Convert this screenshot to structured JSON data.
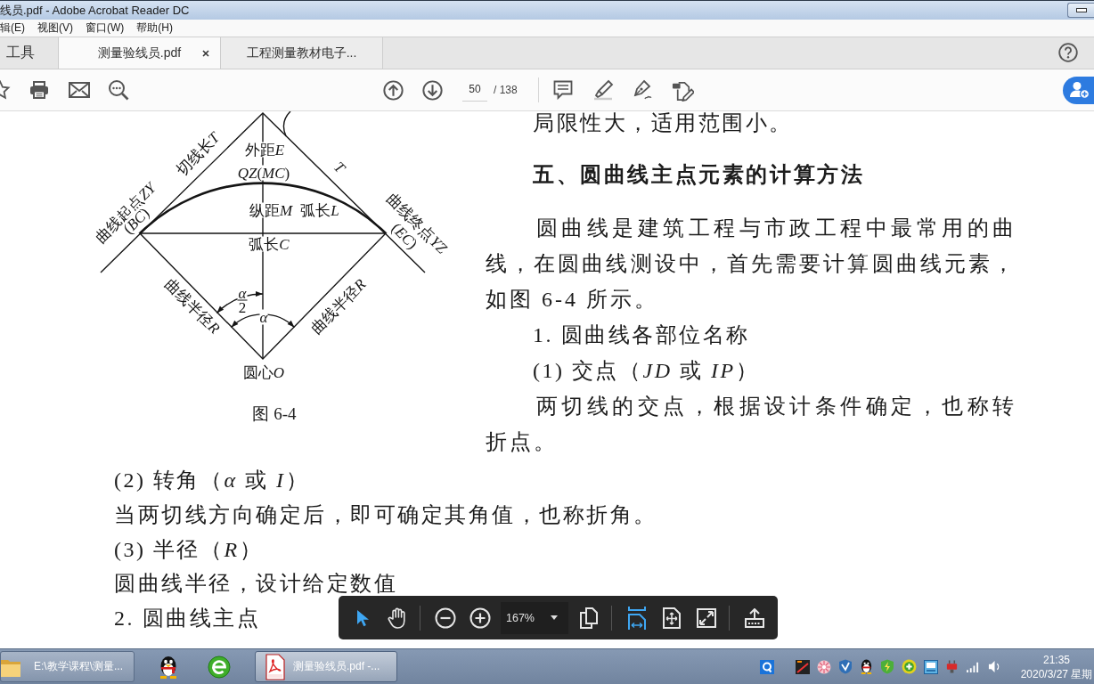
{
  "window": {
    "title": "线员.pdf - Adobe Acrobat Reader DC"
  },
  "menu": [
    "辑(E)",
    "视图(V)",
    "窗口(W)",
    "帮助(H)"
  ],
  "tabs": [
    {
      "label": "工具",
      "selected": false
    },
    {
      "label": "测量验线员.pdf",
      "selected": true
    },
    {
      "label": "工程测量教材电子...",
      "selected": false
    }
  ],
  "page_nav": {
    "page": "50",
    "total": "/ 138"
  },
  "figure": {
    "labels": [
      {
        "kind": "label",
        "text": "外距",
        "symbol": "E"
      },
      {
        "kind": "label",
        "text": "切线长",
        "symbol": "T"
      },
      {
        "kind": "rich",
        "text": "*QZ*(*MC*)"
      },
      {
        "kind": "symbol",
        "text": "T"
      },
      {
        "kind": "label",
        "text": "曲线起点",
        "symbol": "ZY"
      },
      {
        "kind": "rich",
        "text": "(*BC*)"
      },
      {
        "kind": "label",
        "text": "纵距",
        "symbol": "M"
      },
      {
        "kind": "label",
        "text": "弧长",
        "symbol": "L"
      },
      {
        "kind": "label",
        "text": "弧长",
        "symbol": "C"
      },
      {
        "kind": "label",
        "text": "曲线终点",
        "symbol": "YZ"
      },
      {
        "kind": "rich",
        "text": "(*EC*)"
      },
      {
        "kind": "label",
        "text": "曲线半径",
        "symbol": "R"
      },
      {
        "kind": "label",
        "text": "曲线半径",
        "symbol": "R"
      },
      {
        "kind": "fraction",
        "numerator": "α",
        "denominator": "2"
      },
      {
        "kind": "symbol",
        "text": "α"
      },
      {
        "kind": "label",
        "text": "圆心",
        "symbol": "O"
      }
    ],
    "caption": "图 6-4"
  },
  "column": [
    {
      "kind": "text",
      "text": "局限性大，适用范围小。"
    },
    {
      "kind": "heading",
      "text": "五、圆曲线主点元素的计算方法"
    },
    {
      "kind": "paragraph",
      "text": "圆曲线是建筑工程与市政工程中最常用的曲线，在圆曲线测设中，首先需要计算圆曲线元素，如图 6-4 所示。"
    },
    {
      "kind": "text",
      "text": "1. 圆曲线各部位名称"
    },
    {
      "kind": "text",
      "text": "(1) 交点（*JD* 或 *IP*）"
    },
    {
      "kind": "paragraph",
      "text": "两切线的交点，根据设计条件确定，也称转折点。"
    }
  ],
  "body": [
    "(2) 转角（*α* 或 *I*）",
    "当两切线方向确定后，即可确定其角值，也称折角。",
    "(3) 半径（*R*）",
    "圆曲线半径，设计给定数值",
    "2. 圆曲线主点"
  ],
  "view_tools": [
    {
      "kind": "select",
      "selected": true
    },
    {
      "kind": "hand",
      "selected": false
    },
    {
      "kind": "zoom-out",
      "selected": false
    },
    {
      "kind": "zoom-in",
      "selected": false
    },
    {
      "kind": "zoom",
      "label": "167%",
      "selected": false
    },
    {
      "kind": "page-display",
      "selected": false
    },
    {
      "kind": "fit-width",
      "selected": true
    },
    {
      "kind": "fit-page",
      "selected": false
    },
    {
      "kind": "fullscreen",
      "selected": false
    },
    {
      "kind": "share",
      "selected": false
    }
  ],
  "taskbar": {
    "apps": [
      {
        "kind": "folder",
        "label": "E:\\教学课程\\测量...",
        "selected": false
      },
      {
        "kind": "penguin",
        "selected": false
      },
      {
        "kind": "globe",
        "selected": false
      },
      {
        "kind": "pdf",
        "label": "测量验线员.pdf -...",
        "selected": true
      }
    ],
    "time": "21:35",
    "date": "2020/3/27 星期"
  }
}
